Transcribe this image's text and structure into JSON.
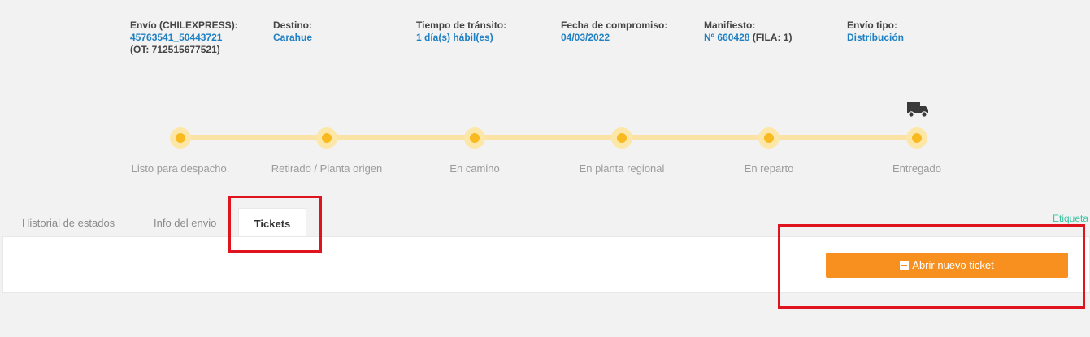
{
  "info": {
    "envio": {
      "label": "Envío (CHILEXPRESS):",
      "value": "45763541_50443721",
      "extra": "(OT: 712515677521)"
    },
    "destino": {
      "label": "Destino:",
      "value": "Carahue"
    },
    "transito": {
      "label": "Tiempo de tránsito:",
      "value": "1 día(s) hábil(es)"
    },
    "fecha": {
      "label": "Fecha de compromiso:",
      "value": "04/03/2022"
    },
    "manifiesto": {
      "label": "Manifiesto:",
      "value": "Nº 660428",
      "extra": "(FILA: 1)"
    },
    "tipo": {
      "label": "Envío tipo:",
      "value": "Distribución"
    }
  },
  "timeline": {
    "steps": [
      {
        "label": "Listo para despacho."
      },
      {
        "label": "Retirado / Planta origen"
      },
      {
        "label": "En camino"
      },
      {
        "label": "En planta regional"
      },
      {
        "label": "En reparto"
      },
      {
        "label": "Entregado"
      }
    ],
    "current_icon": "truck-icon"
  },
  "tabs": {
    "historial": "Historial de estados",
    "info": "Info del envio",
    "tickets": "Tickets",
    "active": "Tickets"
  },
  "etiqueta_link": "Etiqueta",
  "new_ticket_button": "Abrir nuevo ticket",
  "colors": {
    "accent_blue": "#1f80c4",
    "timeline_yellow": "#f9b920",
    "button_orange": "#f7901e",
    "highlight_red": "#e0141e",
    "link_green": "#3bc4a3"
  }
}
